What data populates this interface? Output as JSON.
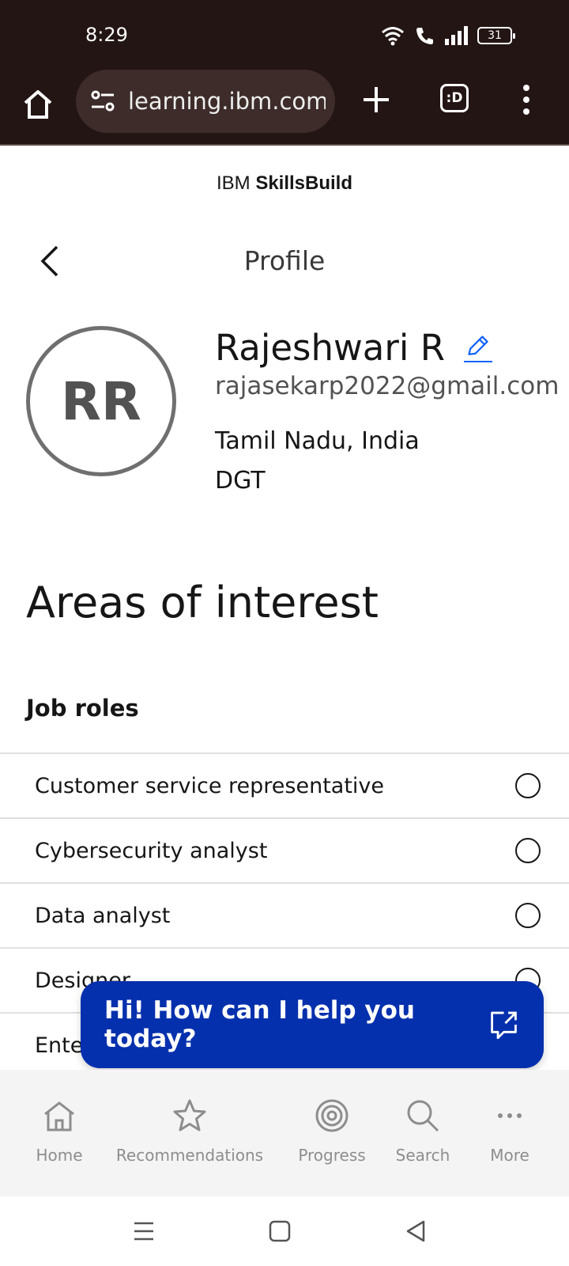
{
  "status_bar": {
    "time": "8:29",
    "battery": "31"
  },
  "browser": {
    "url": "learning.ibm.com",
    "tabs_label": ":D"
  },
  "brand": {
    "prefix": "IBM",
    "name": "SkillsBuild"
  },
  "page": {
    "title": "Profile"
  },
  "profile": {
    "initials": "RR",
    "name": "Rajeshwari R",
    "email": "rajasekarp2022@gmail.com",
    "location": "Tamil Nadu, India",
    "organization": "DGT"
  },
  "interests": {
    "title": "Areas of interest",
    "job_roles_title": "Job roles",
    "job_roles": [
      {
        "label": "Customer service representative"
      },
      {
        "label": "Cybersecurity analyst"
      },
      {
        "label": "Data analyst"
      },
      {
        "label": "Designer"
      },
      {
        "label": "Ente"
      }
    ]
  },
  "chat": {
    "label": "Hi! How can I help you today?"
  },
  "bottom_nav": [
    {
      "label": "Home",
      "icon": "home-icon"
    },
    {
      "label": "Recommendations",
      "icon": "star-icon"
    },
    {
      "label": "Progress",
      "icon": "progress-icon"
    },
    {
      "label": "Search",
      "icon": "search-icon"
    },
    {
      "label": "More",
      "icon": "more-icon"
    }
  ],
  "colors": {
    "chrome_bg": "#231514",
    "chat_bg": "#0530ad",
    "edit_icon": "#0f62fe",
    "nav_bg": "#f4f4f4"
  }
}
